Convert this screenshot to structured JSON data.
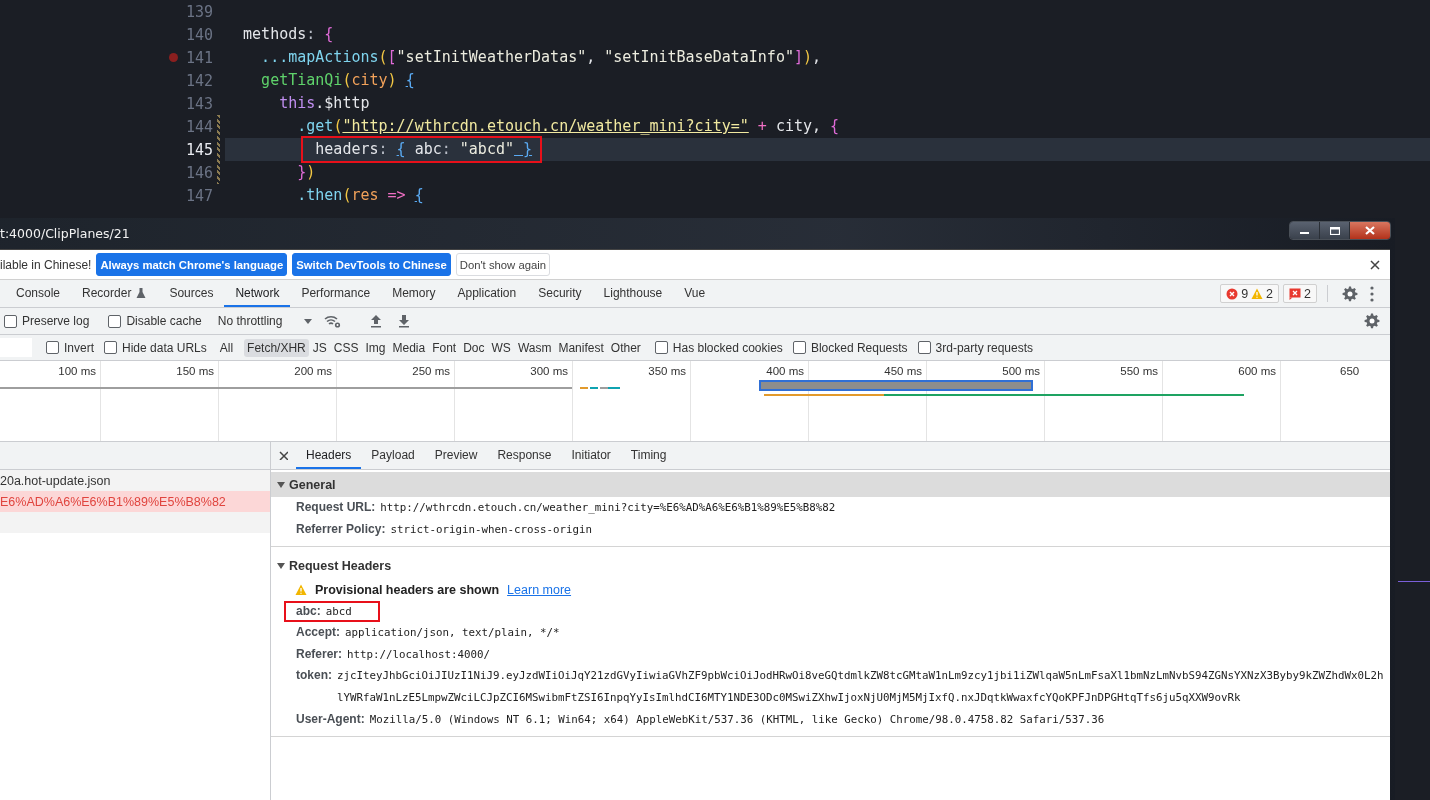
{
  "editor": {
    "lines": [
      {
        "number": "139",
        "breakpoint": false,
        "current": false,
        "modified": false,
        "annotated": false
      },
      {
        "number": "140",
        "breakpoint": false,
        "current": false,
        "modified": false,
        "annotated": false,
        "tokens": [
          {
            "text": "  methods",
            "kind": "plain"
          },
          {
            "text": ": ",
            "kind": "punct"
          },
          {
            "text": "{",
            "kind": "brace1"
          }
        ]
      },
      {
        "number": "141",
        "breakpoint": true,
        "current": false,
        "modified": false,
        "annotated": false,
        "tokens": [
          {
            "text": "    ...mapActions",
            "kind": "fn"
          },
          {
            "text": "(",
            "kind": "brace2"
          },
          {
            "text": "[",
            "kind": "brace1"
          },
          {
            "text": "\"setInitWeatherDatas\"",
            "kind": "string"
          },
          {
            "text": ", ",
            "kind": "plain"
          },
          {
            "text": "\"setInitBaseDataInfo\"",
            "kind": "string"
          },
          {
            "text": "]",
            "kind": "brace1"
          },
          {
            "text": ")",
            "kind": "brace2"
          },
          {
            "text": ",",
            "kind": "plain"
          }
        ]
      },
      {
        "number": "142",
        "breakpoint": false,
        "current": false,
        "modified": false,
        "annotated": false,
        "tokens": [
          {
            "text": "    getTianQi",
            "kind": "method"
          },
          {
            "text": "(",
            "kind": "brace2"
          },
          {
            "text": "city",
            "kind": "param"
          },
          {
            "text": ") ",
            "kind": "brace2"
          },
          {
            "text": "{",
            "kind": "brace3"
          }
        ]
      },
      {
        "number": "143",
        "breakpoint": false,
        "current": false,
        "modified": false,
        "annotated": false,
        "tokens": [
          {
            "text": "      this",
            "kind": "keyword"
          },
          {
            "text": ".$http",
            "kind": "plain"
          }
        ]
      },
      {
        "number": "144",
        "breakpoint": false,
        "current": false,
        "modified": true,
        "annotated": false,
        "tokens": [
          {
            "text": "        .get",
            "kind": "fn"
          },
          {
            "text": "(",
            "kind": "brace2"
          },
          {
            "text": "\"http://wthrcdn.etouch.cn/weather_mini?city=\"",
            "kind": "url"
          },
          {
            "text": " + ",
            "kind": "operator"
          },
          {
            "text": "city, ",
            "kind": "plain"
          },
          {
            "text": "{",
            "kind": "brace1"
          }
        ]
      },
      {
        "number": "145",
        "breakpoint": false,
        "current": true,
        "modified": true,
        "annotated": true,
        "tokens": [
          {
            "text": "          headers",
            "kind": "plain"
          },
          {
            "text": ": ",
            "kind": "punct"
          },
          {
            "text": "{",
            "kind": "brace3"
          },
          {
            "text": " abc",
            "kind": "plain"
          },
          {
            "text": ": ",
            "kind": "punct"
          },
          {
            "text": "\"abcd\"",
            "kind": "string"
          },
          {
            "text": " }",
            "kind": "brace3"
          }
        ]
      },
      {
        "number": "146",
        "breakpoint": false,
        "current": false,
        "modified": true,
        "annotated": false,
        "tokens": [
          {
            "text": "        }",
            "kind": "brace1"
          },
          {
            "text": ")",
            "kind": "brace2"
          }
        ]
      },
      {
        "number": "147",
        "breakpoint": false,
        "current": false,
        "modified": false,
        "annotated": false,
        "tokens": [
          {
            "text": "        .then",
            "kind": "fn"
          },
          {
            "text": "(",
            "kind": "brace2"
          },
          {
            "text": "res",
            "kind": "param"
          },
          {
            "text": " => ",
            "kind": "operator"
          },
          {
            "text": "{",
            "kind": "brace3"
          }
        ]
      }
    ]
  },
  "devtools": {
    "title": "t:4000/ClipPlanes/21",
    "infobar": {
      "message": "ilable in Chinese!",
      "buttons": [
        {
          "label": "Always match Chrome's language",
          "kind": "primary"
        },
        {
          "label": "Switch DevTools to Chinese",
          "kind": "primary"
        },
        {
          "label": "Don't show again",
          "kind": "secondary"
        }
      ]
    },
    "tabs": [
      {
        "label": "Console",
        "selected": false,
        "experimental": false
      },
      {
        "label": "Recorder",
        "selected": false,
        "experimental": true
      },
      {
        "label": "Sources",
        "selected": false,
        "experimental": false
      },
      {
        "label": "Network",
        "selected": true,
        "experimental": false
      },
      {
        "label": "Performance",
        "selected": false,
        "experimental": false
      },
      {
        "label": "Memory",
        "selected": false,
        "experimental": false
      },
      {
        "label": "Application",
        "selected": false,
        "experimental": false
      },
      {
        "label": "Security",
        "selected": false,
        "experimental": false
      },
      {
        "label": "Lighthouse",
        "selected": false,
        "experimental": false
      },
      {
        "label": "Vue",
        "selected": false,
        "experimental": false
      }
    ],
    "counters": {
      "errors": "9",
      "warnings": "2",
      "issues": "2"
    },
    "toolbar": {
      "checkboxes": [
        {
          "label": "Preserve log",
          "checked": false
        },
        {
          "label": "Disable cache",
          "checked": false
        }
      ],
      "throttling": "No throttling"
    },
    "filter": {
      "options": [
        {
          "label": "Invert",
          "checked": false
        },
        {
          "label": "Hide data URLs",
          "checked": false
        }
      ],
      "types": [
        {
          "label": "All",
          "selected": false
        },
        {
          "label": "Fetch/XHR",
          "selected": true
        },
        {
          "label": "JS",
          "selected": false
        },
        {
          "label": "CSS",
          "selected": false
        },
        {
          "label": "Img",
          "selected": false
        },
        {
          "label": "Media",
          "selected": false
        },
        {
          "label": "Font",
          "selected": false
        },
        {
          "label": "Doc",
          "selected": false
        },
        {
          "label": "WS",
          "selected": false
        },
        {
          "label": "Wasm",
          "selected": false
        },
        {
          "label": "Manifest",
          "selected": false
        },
        {
          "label": "Other",
          "selected": false
        }
      ],
      "extras": [
        {
          "label": "Has blocked cookies",
          "checked": false
        },
        {
          "label": "Blocked Requests",
          "checked": false
        },
        {
          "label": "3rd-party requests",
          "checked": false
        }
      ]
    },
    "timeline": {
      "ticks": [
        "100 ms",
        "150 ms",
        "200 ms",
        "250 ms",
        "300 ms",
        "350 ms",
        "400 ms",
        "450 ms",
        "500 ms",
        "550 ms",
        "600 ms",
        "650"
      ]
    },
    "requests": [
      {
        "name": "20a.hot-update.json",
        "failed": false,
        "selected": false
      },
      {
        "name": "E6%AD%A6%E6%B1%89%E5%B8%82",
        "failed": true,
        "selected": true
      }
    ],
    "detail": {
      "tabs": [
        {
          "label": "Headers",
          "selected": true
        },
        {
          "label": "Payload",
          "selected": false
        },
        {
          "label": "Preview",
          "selected": false
        },
        {
          "label": "Response",
          "selected": false
        },
        {
          "label": "Initiator",
          "selected": false
        },
        {
          "label": "Timing",
          "selected": false
        }
      ],
      "sections": [
        {
          "title": "General",
          "expanded": true,
          "highlighted": true,
          "rows": [
            {
              "name": "Request URL:",
              "value": "http://wthrcdn.etouch.cn/weather_mini?city=%E6%AD%A6%E6%B1%89%E5%B8%82",
              "annotated": false
            },
            {
              "name": "Referrer Policy:",
              "value": "strict-origin-when-cross-origin",
              "annotated": false
            }
          ]
        },
        {
          "title": "Request Headers",
          "expanded": true,
          "highlighted": false,
          "notice": {
            "text": "Provisional headers are shown",
            "link": "Learn more"
          },
          "rows": [
            {
              "name": "abc:",
              "value": "abcd",
              "annotated": true
            },
            {
              "name": "Accept:",
              "value": "application/json, text/plain, */*",
              "annotated": false
            },
            {
              "name": "Referer:",
              "value": "http://localhost:4000/",
              "annotated": false
            },
            {
              "name": "token:",
              "value": "zjcIteyJhbGciOiJIUzI1NiJ9.eyJzdWIiOiJqY21zdGVyIiwiaGVhZF9pbWciOiJodHRwOi8veGQtdmlkZW8tcGMtaW1nLm9zcy1jbi1iZWlqaW5nLmFsaXl1bmNzLmNvbS94ZGNsYXNzX3Byby9kZWZhdWx0L2hlYWRfaW1nLzE5LmpwZWciLCJpZCI6MSwibmFtZSI6InpqYyIsImlhdCI6MTY1NDE3ODc0MSwiZXhwIjoxNjU0MjM5MjIxfQ.nxJDqtkWwaxfcYQoKPFJnDPGHtqTfs6ju5qXXW9ovRk",
              "annotated": false
            },
            {
              "name": "User-Agent:",
              "value": "Mozilla/5.0 (Windows NT 6.1; Win64; x64) AppleWebKit/537.36 (KHTML, like Gecko) Chrome/98.0.4758.82 Safari/537.36",
              "annotated": false
            }
          ]
        }
      ]
    }
  }
}
